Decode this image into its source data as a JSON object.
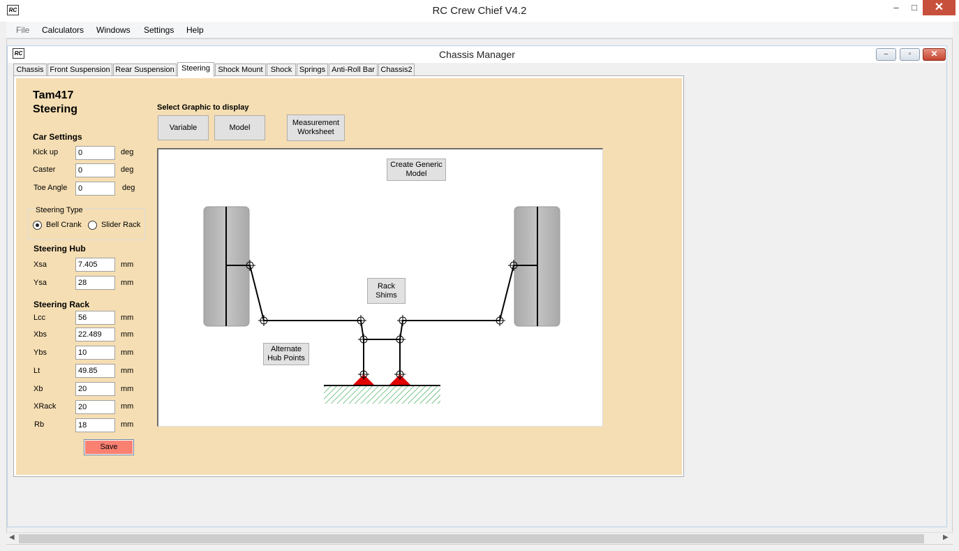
{
  "app": {
    "title": "RC Crew Chief V4.2",
    "icon": "RC"
  },
  "window_controls": {
    "minimize": "–",
    "maximize": "□",
    "close": "✕"
  },
  "menu": {
    "items": [
      "File",
      "Calculators",
      "Windows",
      "Settings",
      "Help"
    ]
  },
  "child": {
    "title": "Chassis Manager",
    "icon": "RC",
    "controls": {
      "minimize": "–",
      "restore": "▫",
      "close": "✕"
    }
  },
  "tabs": [
    "Chassis",
    "Front Suspension",
    "Rear Suspension",
    "Steering",
    "Shock Mount",
    "Shock",
    "Springs",
    "Anti-Roll Bar",
    "Chassis2"
  ],
  "active_tab": "Steering",
  "header": {
    "car": "Tam417",
    "page": "Steering"
  },
  "car_settings": {
    "heading": "Car Settings",
    "kick_up": {
      "label": "Kick up",
      "value": "0",
      "unit": "deg"
    },
    "caster": {
      "label": "Caster",
      "value": "0",
      "unit": "deg"
    },
    "toe_angle": {
      "label": "Toe Angle",
      "value": "0",
      "unit": "deg"
    }
  },
  "steering_type": {
    "label": "Steering Type",
    "options": [
      "Bell Crank",
      "Slider Rack"
    ],
    "selected": "Bell Crank"
  },
  "steering_hub": {
    "heading": "Steering Hub",
    "xsa": {
      "label": "Xsa",
      "value": "7.405",
      "unit": "mm"
    },
    "ysa": {
      "label": "Ysa",
      "value": "28",
      "unit": "mm"
    }
  },
  "steering_rack": {
    "heading": "Steering Rack",
    "lcc": {
      "label": "Lcc",
      "value": "56",
      "unit": "mm"
    },
    "xbs": {
      "label": "Xbs",
      "value": "22.489",
      "unit": "mm"
    },
    "ybs": {
      "label": "Ybs",
      "value": "10",
      "unit": "mm"
    },
    "lt": {
      "label": "Lt",
      "value": "49.85",
      "unit": "mm"
    },
    "xb": {
      "label": "Xb",
      "value": "20",
      "unit": "mm"
    },
    "xrack": {
      "label": "XRack",
      "value": "20",
      "unit": "mm"
    },
    "rb": {
      "label": "Rb",
      "value": "18",
      "unit": "mm"
    }
  },
  "save_label": "Save",
  "graphic": {
    "heading": "Select Graphic to display",
    "variable_btn": "Variable",
    "model_btn": "Model",
    "measurement_btn": "Measurement Worksheet",
    "create_generic_btn": "Create Generic Model",
    "rack_shims_btn": "Rack Shims",
    "alt_hub_btn": "Alternate Hub Points"
  },
  "colors": {
    "panel_bg": "#f5deb3",
    "save_button": "#fa8072",
    "mount_red": "#e00000",
    "ground_hatch": "#1f9d3a",
    "wheel_gray": "#b8b8b8"
  }
}
